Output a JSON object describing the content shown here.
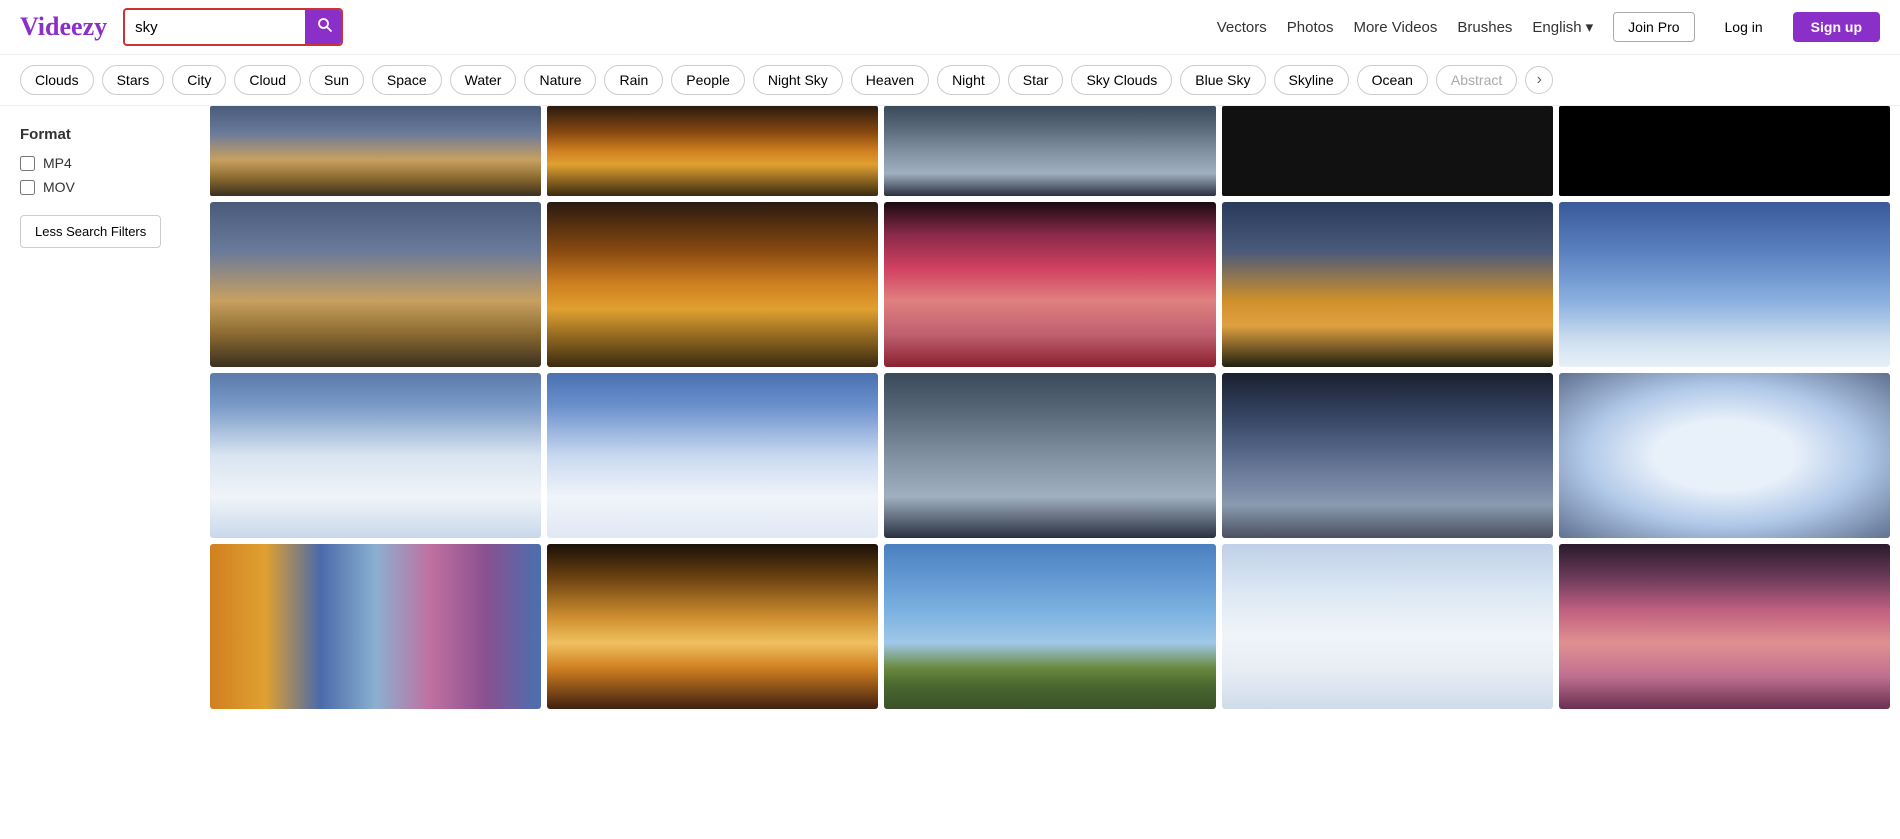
{
  "header": {
    "logo": "Videezy",
    "search_value": "sky",
    "nav": {
      "vectors": "Vectors",
      "photos": "Photos",
      "more_videos": "More Videos",
      "brushes": "Brushes",
      "language": "English",
      "join_pro": "Join Pro",
      "login": "Log in",
      "signup": "Sign up"
    }
  },
  "tags": [
    "Clouds",
    "Stars",
    "City",
    "Cloud",
    "Sun",
    "Space",
    "Water",
    "Nature",
    "Rain",
    "People",
    "Night Sky",
    "Heaven",
    "Night",
    "Star",
    "Sky Clouds",
    "Blue Sky",
    "Skyline",
    "Ocean",
    "Abstract"
  ],
  "sidebar": {
    "format_label": "Format",
    "mp4_label": "MP4",
    "mov_label": "MOV",
    "filter_button": "Less Search Filters"
  },
  "grid": {
    "rows": [
      {
        "id": "partial",
        "thumbs": [
          "partial1",
          "partial2",
          "partial3",
          "partial4",
          "partial5"
        ]
      },
      {
        "id": "row1",
        "thumbs": [
          "sunset_clouds",
          "orange_sunset",
          "pink_sky",
          "city_sunset",
          "blue_cloud"
        ]
      },
      {
        "id": "row2",
        "thumbs": [
          "blue_clouds",
          "white_clouds",
          "dark_clouds",
          "dramatic_clouds",
          "white_swirl"
        ]
      },
      {
        "id": "row3",
        "thumbs": [
          "sky_strips",
          "golden_sunset",
          "sky_field",
          "white_soft_clouds",
          "pink_dusk"
        ]
      }
    ]
  }
}
